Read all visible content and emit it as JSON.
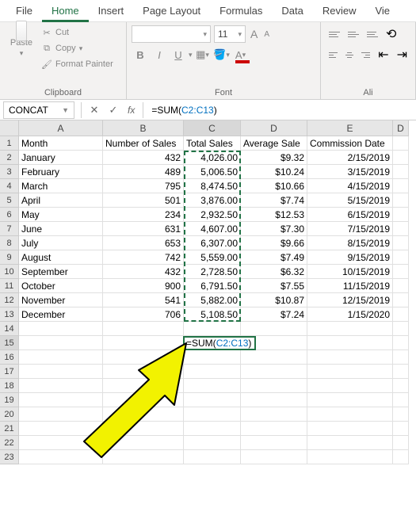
{
  "tabs": [
    "File",
    "Home",
    "Insert",
    "Page Layout",
    "Formulas",
    "Data",
    "Review",
    "Vie"
  ],
  "active_tab": "Home",
  "ribbon": {
    "clipboard": {
      "paste": "Paste",
      "cut": "Cut",
      "copy": "Copy",
      "painter": "Format Painter",
      "label": "Clipboard"
    },
    "font": {
      "size": "11",
      "bold": "B",
      "italic": "I",
      "underline": "U",
      "bigA": "A",
      "smallA": "A",
      "label": "Font"
    },
    "align": {
      "label": "Ali"
    }
  },
  "namebox": "CONCAT",
  "fx_btns": {
    "cancel": "✕",
    "enter": "✓"
  },
  "fx_label": "fx",
  "formula": {
    "prefix": "=SUM(",
    "ref": "C2:C13",
    "suffix": ")"
  },
  "columns": [
    "A",
    "B",
    "C",
    "D",
    "E",
    "D"
  ],
  "row_numbers": [
    1,
    2,
    3,
    4,
    5,
    6,
    7,
    8,
    9,
    10,
    11,
    12,
    13,
    14,
    15,
    16,
    17,
    18,
    19,
    20,
    21,
    22,
    23
  ],
  "headers": {
    "A": "Month",
    "B": "Number of Sales",
    "C": "Total Sales",
    "D": "Average Sale",
    "E": "Commission Date"
  },
  "data": [
    {
      "month": "January",
      "num": "432",
      "total": "4,026.00",
      "avg": "$9.32",
      "date": "2/15/2019"
    },
    {
      "month": "February",
      "num": "489",
      "total": "5,006.50",
      "avg": "$10.24",
      "date": "3/15/2019"
    },
    {
      "month": "March",
      "num": "795",
      "total": "8,474.50",
      "avg": "$10.66",
      "date": "4/15/2019"
    },
    {
      "month": "April",
      "num": "501",
      "total": "3,876.00",
      "avg": "$7.74",
      "date": "5/15/2019"
    },
    {
      "month": "May",
      "num": "234",
      "total": "2,932.50",
      "avg": "$12.53",
      "date": "6/15/2019"
    },
    {
      "month": "June",
      "num": "631",
      "total": "4,607.00",
      "avg": "$7.30",
      "date": "7/15/2019"
    },
    {
      "month": "July",
      "num": "653",
      "total": "6,307.00",
      "avg": "$9.66",
      "date": "8/15/2019"
    },
    {
      "month": "August",
      "num": "742",
      "total": "5,559.00",
      "avg": "$7.49",
      "date": "9/15/2019"
    },
    {
      "month": "September",
      "num": "432",
      "total": "2,728.50",
      "avg": "$6.32",
      "date": "10/15/2019"
    },
    {
      "month": "October",
      "num": "900",
      "total": "6,791.50",
      "avg": "$7.55",
      "date": "11/15/2019"
    },
    {
      "month": "November",
      "num": "541",
      "total": "5,882.00",
      "avg": "$10.87",
      "date": "12/15/2019"
    },
    {
      "month": "December",
      "num": "706",
      "total": "5,108.50",
      "avg": "$7.24",
      "date": "1/15/2020"
    }
  ],
  "edit": {
    "eq": "=",
    "fn": "SUM(",
    "ref": "C2:C13",
    "close": ")"
  }
}
